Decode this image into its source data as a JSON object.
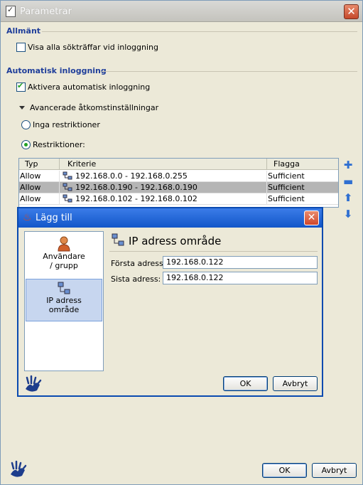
{
  "window": {
    "title": "Parametrar",
    "ok_label": "OK",
    "cancel_label": "Avbryt"
  },
  "general": {
    "section_title": "Allmänt",
    "show_all_hits_label": "Visa alla sökträffar vid inloggning",
    "show_all_hits_checked": false
  },
  "auto_login": {
    "section_title": "Automatisk inloggning",
    "enable_label": "Aktivera automatisk inloggning",
    "enable_checked": true,
    "advanced_label": "Avancerade åtkomstinställningar",
    "no_restrictions_label": "Inga restriktioner",
    "restrictions_label": "Restriktioner:",
    "selected_option": "restrictions"
  },
  "table": {
    "columns": [
      "Typ",
      "Kriterie",
      "Flagga"
    ],
    "rows": [
      {
        "type": "Allow",
        "criteria": "192.168.0.0 - 192.168.0.255",
        "flag": "Sufficient",
        "selected": false
      },
      {
        "type": "Allow",
        "criteria": "192.168.0.190 - 192.168.0.190",
        "flag": "Sufficient",
        "selected": true
      },
      {
        "type": "Allow",
        "criteria": "192.168.0.102 - 192.168.0.102",
        "flag": "Sufficient",
        "selected": false
      }
    ]
  },
  "side_buttons": {
    "add": "plus-icon",
    "remove": "minus-icon",
    "up": "arrow-up-icon",
    "down": "arrow-down-icon"
  },
  "dialog": {
    "title": "Lägg till",
    "pane_items": [
      {
        "label_line1": "Användare",
        "label_line2": "/ grupp",
        "icon": "user-icon",
        "selected": false
      },
      {
        "label_line1": "IP adress",
        "label_line2": "område",
        "icon": "network-icon",
        "selected": true
      }
    ],
    "heading": "IP adress område",
    "first_address_label": "Första adress:",
    "first_address_value": "192.168.0.122",
    "last_address_label": "Sista adress:",
    "last_address_value": "192.168.0.122",
    "ok_label": "OK",
    "cancel_label": "Avbryt"
  },
  "colors": {
    "section_title": "#1f3e9a",
    "dialog_title_bar": "#1256c9",
    "selected_row": "#b5b5b5",
    "check_green": "#21a121"
  }
}
